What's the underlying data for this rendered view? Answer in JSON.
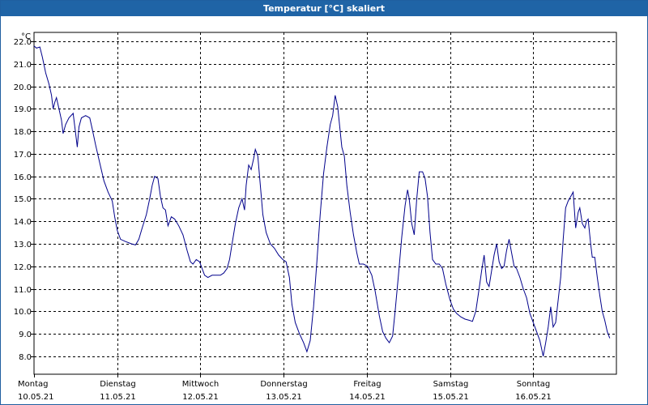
{
  "window": {
    "title": "Temperatur [°C] skaliert"
  },
  "chart_data": {
    "type": "line",
    "title": "Temperatur [°C] skaliert",
    "ylabel": "°C",
    "xlabel": "",
    "ylim": [
      7.2,
      22.4
    ],
    "yticks": [
      "22.0",
      "21.0",
      "20.0",
      "19.0",
      "18.0",
      "17.0",
      "16.0",
      "15.0",
      "14.0",
      "13.0",
      "12.0",
      "11.0",
      "10.0",
      "9.0",
      "8.0"
    ],
    "ytick_values": [
      22,
      21,
      20,
      19,
      18,
      17,
      16,
      15,
      14,
      13,
      12,
      11,
      10,
      9,
      8
    ],
    "days": [
      {
        "weekday": "Montag",
        "date": "10.05.21"
      },
      {
        "weekday": "Dienstag",
        "date": "11.05.21"
      },
      {
        "weekday": "Mittwoch",
        "date": "12.05.21"
      },
      {
        "weekday": "Donnerstag",
        "date": "13.05.21"
      },
      {
        "weekday": "Freitag",
        "date": "14.05.21"
      },
      {
        "weekday": "Samstag",
        "date": "15.05.21"
      },
      {
        "weekday": "Sonntag",
        "date": "16.05.21"
      }
    ],
    "x_unit": "days since 10.05.21 00:00",
    "xlim": [
      0,
      7.0
    ],
    "grid": true,
    "colors": {
      "line": "#00008b",
      "grid": "#000000",
      "titlebar": "#1f64a6"
    },
    "series": [
      {
        "name": "",
        "points": [
          [
            0.0,
            21.8
          ],
          [
            0.03,
            21.7
          ],
          [
            0.07,
            21.75
          ],
          [
            0.1,
            21.3
          ],
          [
            0.14,
            20.6
          ],
          [
            0.18,
            20.1
          ],
          [
            0.21,
            19.6
          ],
          [
            0.23,
            19.0
          ],
          [
            0.25,
            19.3
          ],
          [
            0.27,
            19.5
          ],
          [
            0.3,
            19.0
          ],
          [
            0.33,
            18.5
          ],
          [
            0.35,
            17.9
          ],
          [
            0.38,
            18.3
          ],
          [
            0.42,
            18.6
          ],
          [
            0.47,
            18.8
          ],
          [
            0.5,
            17.9
          ],
          [
            0.52,
            17.3
          ],
          [
            0.54,
            18.2
          ],
          [
            0.57,
            18.6
          ],
          [
            0.62,
            18.7
          ],
          [
            0.67,
            18.6
          ],
          [
            0.7,
            18.1
          ],
          [
            0.74,
            17.4
          ],
          [
            0.79,
            16.6
          ],
          [
            0.84,
            15.8
          ],
          [
            0.89,
            15.3
          ],
          [
            0.94,
            14.9
          ],
          [
            0.97,
            14.2
          ],
          [
            1.0,
            13.6
          ],
          [
            1.04,
            13.2
          ],
          [
            1.1,
            13.1
          ],
          [
            1.17,
            13.0
          ],
          [
            1.22,
            12.95
          ],
          [
            1.26,
            13.2
          ],
          [
            1.3,
            13.7
          ],
          [
            1.35,
            14.3
          ],
          [
            1.39,
            15.0
          ],
          [
            1.42,
            15.6
          ],
          [
            1.45,
            16.0
          ],
          [
            1.49,
            15.9
          ],
          [
            1.52,
            15.1
          ],
          [
            1.55,
            14.6
          ],
          [
            1.58,
            14.5
          ],
          [
            1.61,
            13.8
          ],
          [
            1.65,
            14.2
          ],
          [
            1.69,
            14.1
          ],
          [
            1.74,
            13.8
          ],
          [
            1.79,
            13.4
          ],
          [
            1.84,
            12.7
          ],
          [
            1.88,
            12.2
          ],
          [
            1.91,
            12.1
          ],
          [
            1.95,
            12.3
          ],
          [
            1.99,
            12.2
          ],
          [
            2.02,
            11.9
          ],
          [
            2.05,
            11.6
          ],
          [
            2.09,
            11.5
          ],
          [
            2.14,
            11.6
          ],
          [
            2.19,
            11.6
          ],
          [
            2.24,
            11.6
          ],
          [
            2.28,
            11.7
          ],
          [
            2.32,
            11.9
          ],
          [
            2.35,
            12.3
          ],
          [
            2.38,
            13.0
          ],
          [
            2.42,
            13.9
          ],
          [
            2.46,
            14.6
          ],
          [
            2.5,
            15.0
          ],
          [
            2.53,
            14.5
          ],
          [
            2.55,
            15.6
          ],
          [
            2.58,
            16.5
          ],
          [
            2.61,
            16.3
          ],
          [
            2.64,
            16.8
          ],
          [
            2.66,
            17.2
          ],
          [
            2.69,
            16.9
          ],
          [
            2.72,
            15.6
          ],
          [
            2.75,
            14.3
          ],
          [
            2.79,
            13.5
          ],
          [
            2.84,
            13.0
          ],
          [
            2.89,
            12.8
          ],
          [
            2.94,
            12.5
          ],
          [
            2.99,
            12.3
          ],
          [
            3.03,
            12.2
          ],
          [
            3.07,
            11.5
          ],
          [
            3.1,
            10.3
          ],
          [
            3.14,
            9.5
          ],
          [
            3.19,
            9.0
          ],
          [
            3.24,
            8.6
          ],
          [
            3.28,
            8.2
          ],
          [
            3.32,
            8.7
          ],
          [
            3.36,
            10.2
          ],
          [
            3.4,
            12.2
          ],
          [
            3.44,
            14.3
          ],
          [
            3.48,
            16.1
          ],
          [
            3.52,
            17.3
          ],
          [
            3.56,
            18.3
          ],
          [
            3.59,
            18.7
          ],
          [
            3.62,
            19.6
          ],
          [
            3.65,
            19.1
          ],
          [
            3.68,
            18.0
          ],
          [
            3.7,
            17.3
          ],
          [
            3.73,
            16.9
          ],
          [
            3.76,
            15.6
          ],
          [
            3.8,
            14.4
          ],
          [
            3.84,
            13.4
          ],
          [
            3.88,
            12.6
          ],
          [
            3.91,
            12.1
          ],
          [
            3.96,
            12.1
          ],
          [
            4.01,
            12.0
          ],
          [
            4.06,
            11.6
          ],
          [
            4.1,
            10.9
          ],
          [
            4.15,
            9.8
          ],
          [
            4.19,
            9.1
          ],
          [
            4.23,
            8.8
          ],
          [
            4.27,
            8.6
          ],
          [
            4.31,
            8.9
          ],
          [
            4.34,
            10.0
          ],
          [
            4.38,
            11.6
          ],
          [
            4.42,
            13.3
          ],
          [
            4.46,
            14.7
          ],
          [
            4.49,
            15.4
          ],
          [
            4.51,
            15.0
          ],
          [
            4.54,
            13.9
          ],
          [
            4.57,
            13.4
          ],
          [
            4.6,
            15.0
          ],
          [
            4.63,
            16.2
          ],
          [
            4.67,
            16.2
          ],
          [
            4.7,
            15.9
          ],
          [
            4.73,
            15.1
          ],
          [
            4.76,
            13.5
          ],
          [
            4.79,
            12.3
          ],
          [
            4.83,
            12.1
          ],
          [
            4.87,
            12.1
          ],
          [
            4.91,
            11.9
          ],
          [
            4.95,
            11.2
          ],
          [
            5.0,
            10.5
          ],
          [
            5.04,
            10.1
          ],
          [
            5.08,
            9.9
          ],
          [
            5.13,
            9.75
          ],
          [
            5.18,
            9.65
          ],
          [
            5.23,
            9.6
          ],
          [
            5.27,
            9.55
          ],
          [
            5.31,
            10.0
          ],
          [
            5.35,
            11.0
          ],
          [
            5.38,
            11.8
          ],
          [
            5.41,
            12.5
          ],
          [
            5.44,
            11.3
          ],
          [
            5.47,
            11.1
          ],
          [
            5.5,
            11.8
          ],
          [
            5.53,
            12.5
          ],
          [
            5.56,
            13.0
          ],
          [
            5.59,
            12.2
          ],
          [
            5.62,
            11.9
          ],
          [
            5.65,
            12.0
          ],
          [
            5.68,
            12.7
          ],
          [
            5.71,
            13.2
          ],
          [
            5.74,
            12.6
          ],
          [
            5.77,
            12.0
          ],
          [
            5.8,
            11.9
          ],
          [
            5.84,
            11.5
          ],
          [
            5.88,
            11.0
          ],
          [
            5.92,
            10.6
          ],
          [
            5.96,
            9.9
          ],
          [
            6.0,
            9.5
          ],
          [
            6.04,
            9.1
          ],
          [
            6.08,
            8.7
          ],
          [
            6.12,
            8.0
          ],
          [
            6.15,
            8.6
          ],
          [
            6.18,
            9.3
          ],
          [
            6.21,
            10.2
          ],
          [
            6.24,
            9.3
          ],
          [
            6.27,
            9.5
          ],
          [
            6.3,
            10.5
          ],
          [
            6.33,
            11.5
          ],
          [
            6.36,
            13.2
          ],
          [
            6.39,
            14.6
          ],
          [
            6.42,
            14.9
          ],
          [
            6.45,
            15.1
          ],
          [
            6.48,
            15.3
          ],
          [
            6.51,
            13.7
          ],
          [
            6.54,
            14.4
          ],
          [
            6.56,
            14.6
          ],
          [
            6.59,
            13.9
          ],
          [
            6.62,
            13.7
          ],
          [
            6.64,
            14.0
          ],
          [
            6.66,
            14.1
          ],
          [
            6.69,
            13.0
          ],
          [
            6.71,
            12.4
          ],
          [
            6.74,
            12.4
          ],
          [
            6.77,
            11.5
          ],
          [
            6.8,
            10.7
          ],
          [
            6.83,
            10.0
          ],
          [
            6.86,
            9.6
          ],
          [
            6.89,
            9.1
          ],
          [
            6.92,
            8.8
          ]
        ]
      }
    ]
  }
}
